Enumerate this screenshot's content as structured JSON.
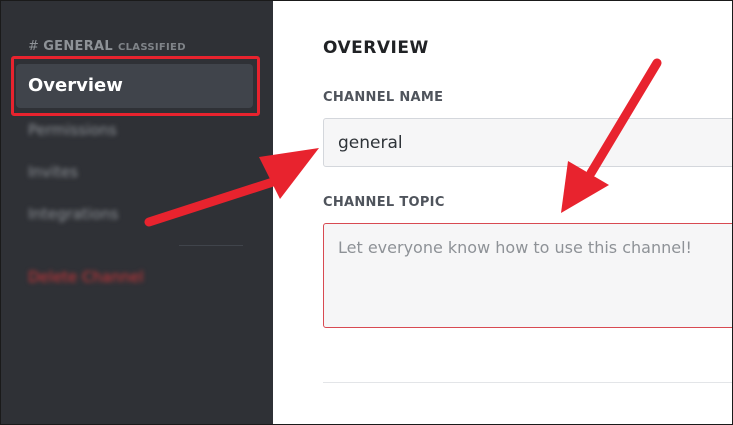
{
  "sidebar": {
    "channel_hash": "#",
    "channel_name": "GENERAL",
    "channel_category": "CLASSIFIED",
    "items": [
      {
        "label": "Overview"
      },
      {
        "label": "Permissions"
      },
      {
        "label": "Invites"
      },
      {
        "label": "Integrations"
      }
    ],
    "delete_label": "Delete Channel"
  },
  "main": {
    "title": "OVERVIEW",
    "channel_name_label": "CHANNEL NAME",
    "channel_name_value": "general",
    "channel_topic_label": "CHANNEL TOPIC",
    "channel_topic_placeholder": "Let everyone know how to use this channel!"
  },
  "colors": {
    "sidebar_bg": "#2f3136",
    "annotation_red": "#e8232e",
    "danger_red": "#d0363a"
  }
}
